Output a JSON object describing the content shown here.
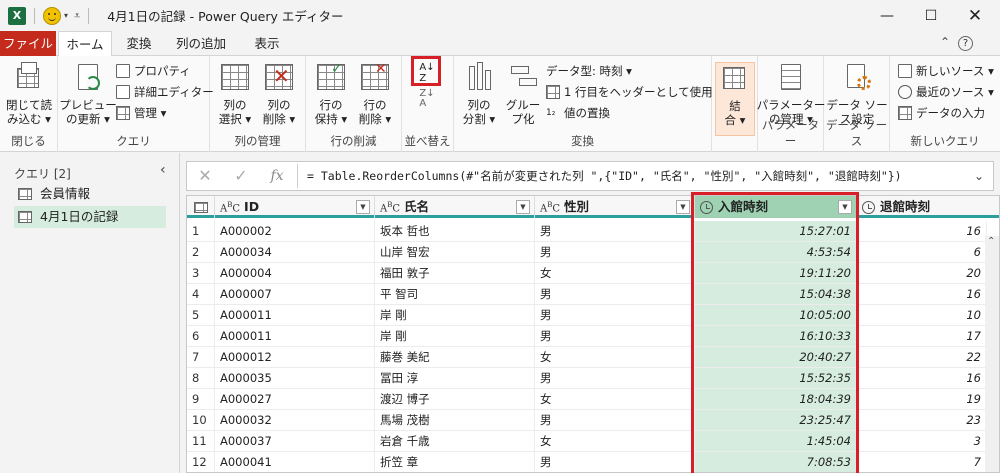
{
  "title_bar": {
    "app_icon": "X",
    "window_title": "4月1日の記録 - Power Query エディター",
    "controls": [
      "minimize-icon",
      "maximize-icon",
      "close-icon"
    ]
  },
  "tabs": {
    "file": "ファイル",
    "home": "ホーム",
    "transform": "変換",
    "add_column": "列の追加",
    "view": "表示"
  },
  "ribbon": {
    "close_group": {
      "label": "閉じる",
      "button": "閉じて読\nみ込む ▾"
    },
    "query_group": {
      "label": "クエリ",
      "preview_button": "プレビュー\nの更新 ▾",
      "properties": "プロパティ",
      "advanced_editor": "詳細エディター",
      "manage": "管理 ▾"
    },
    "columns_group": {
      "label": "列の管理",
      "choose": "列の\n選択 ▾",
      "remove": "列の\n削除 ▾"
    },
    "rows_group": {
      "label": "行の削減",
      "keep": "行の\n保持 ▾",
      "remove": "行の\n削除 ▾"
    },
    "sort_group": {
      "label": "並べ替え"
    },
    "transform_group": {
      "label": "変換",
      "split": "列の\n分割 ▾",
      "group_by": "グルー\nプ化",
      "data_type": "データ型: 時刻 ▾",
      "use_header": "1 行目をヘッダーとして使用 ▾",
      "replace": "値の置換"
    },
    "combine_group": {
      "button": "結\n合 ▾"
    },
    "params_group": {
      "label": "パラメーター",
      "button": "パラメーター\nの管理 ▾"
    },
    "datasource_group": {
      "label": "データ ソース",
      "button": "データ ソー\nス設定"
    },
    "newquery_group": {
      "label": "新しいクエリ",
      "new_source": "新しいソース ▾",
      "recent": "最近のソース ▾",
      "enter_data": "データの入力"
    }
  },
  "queries_panel": {
    "title": "クエリ [2]",
    "items": [
      "会員情報",
      "4月1日の記録"
    ]
  },
  "formula_bar": {
    "fx": "fx",
    "formula": "= Table.ReorderColumns(#\"名前が変更された列 \",{\"ID\", \"氏名\", \"性別\", \"入館時刻\", \"退館時刻\"})"
  },
  "grid": {
    "columns": [
      {
        "name": "ID",
        "type": "ABC"
      },
      {
        "name": "氏名",
        "type": "ABC"
      },
      {
        "name": "性別",
        "type": "ABC"
      },
      {
        "name": "入館時刻",
        "type": "time"
      },
      {
        "name": "退館時刻",
        "type": "time"
      }
    ],
    "rows": [
      {
        "n": "1",
        "id": "A000002",
        "name": "坂本 哲也",
        "sex": "男",
        "in": "15:27:01",
        "out": "16"
      },
      {
        "n": "2",
        "id": "A000034",
        "name": "山岸 智宏",
        "sex": "男",
        "in": "4:53:54",
        "out": "6"
      },
      {
        "n": "3",
        "id": "A000004",
        "name": "福田 敦子",
        "sex": "女",
        "in": "19:11:20",
        "out": "20"
      },
      {
        "n": "4",
        "id": "A000007",
        "name": "平 智司",
        "sex": "男",
        "in": "15:04:38",
        "out": "16"
      },
      {
        "n": "5",
        "id": "A000011",
        "name": "岸 剛",
        "sex": "男",
        "in": "10:05:00",
        "out": "10"
      },
      {
        "n": "6",
        "id": "A000011",
        "name": "岸 剛",
        "sex": "男",
        "in": "16:10:33",
        "out": "17"
      },
      {
        "n": "7",
        "id": "A000012",
        "name": "藤巻 美紀",
        "sex": "女",
        "in": "20:40:27",
        "out": "22"
      },
      {
        "n": "8",
        "id": "A000035",
        "name": "冨田 淳",
        "sex": "男",
        "in": "15:52:35",
        "out": "16"
      },
      {
        "n": "9",
        "id": "A000027",
        "name": "渡辺 博子",
        "sex": "女",
        "in": "18:04:39",
        "out": "19"
      },
      {
        "n": "10",
        "id": "A000032",
        "name": "馬場 茂樹",
        "sex": "男",
        "in": "23:25:47",
        "out": "23"
      },
      {
        "n": "11",
        "id": "A000037",
        "name": "岩倉 千歳",
        "sex": "女",
        "in": "1:45:04",
        "out": "3"
      },
      {
        "n": "12",
        "id": "A000041",
        "name": "折笠 章",
        "sex": "男",
        "in": "7:08:53",
        "out": "7"
      }
    ]
  },
  "colors": {
    "file_tab": "#c42b1c",
    "selection_fill": "#d5ecdf",
    "highlight_box": "#d61f26",
    "header_underline": "#2b9fa0"
  }
}
